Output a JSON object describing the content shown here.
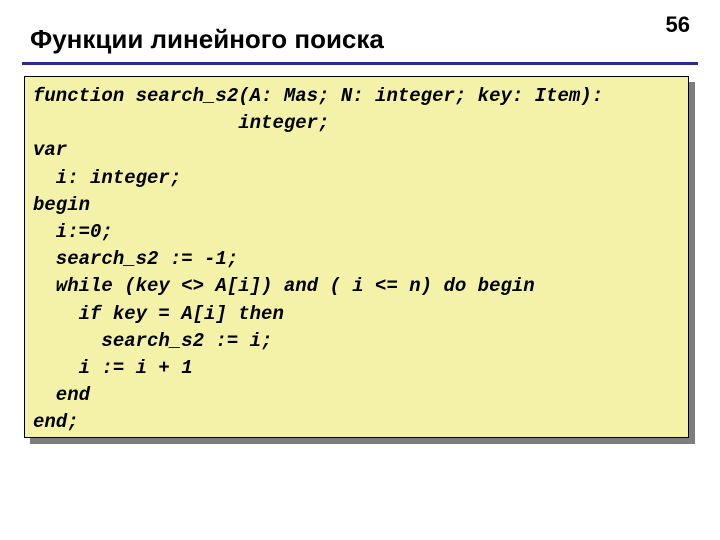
{
  "page_number": "56",
  "title": "Функции линейного поиска",
  "code": "function search_s2(A: Mas; N: integer; key: Item):\n                  integer;\nvar\n  i: integer;\nbegin\n  i:=0;\n  search_s2 := -1;\n  while (key <> A[i]) and ( i <= n) do begin\n    if key = A[i] then\n      search_s2 := i;\n    i := i + 1\n  end\nend;"
}
